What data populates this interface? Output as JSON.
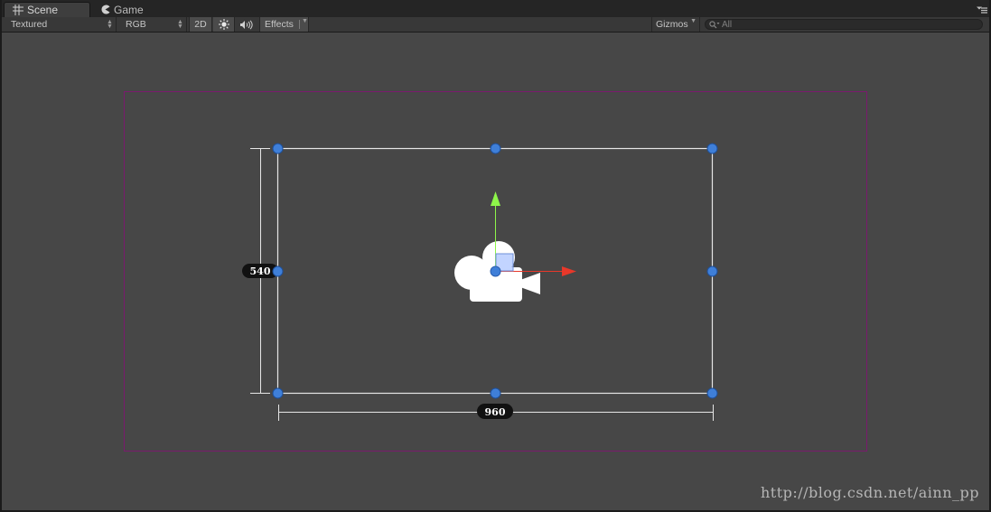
{
  "tabs": [
    {
      "label": "Scene",
      "icon": "scene-grid-icon",
      "active": true
    },
    {
      "label": "Game",
      "icon": "game-pacman-icon",
      "active": false
    }
  ],
  "toolbar": {
    "draw_mode": "Textured",
    "render_mode": "RGB",
    "mode_2d": "2D",
    "lighting_icon": "sun-icon",
    "audio_icon": "speaker-icon",
    "effects": "Effects",
    "gizmos": "Gizmos",
    "search_placeholder": "All"
  },
  "scene": {
    "width_label": "960",
    "height_label": "540",
    "camera_icon": "camera-icon",
    "colors": {
      "background": "#474747",
      "camera_bounds": "#7a1a6e",
      "rect_outline": "#e6e6e6",
      "handle": "#3f7fd8",
      "y_axis": "#8ef54a",
      "x_axis": "#e8382a"
    }
  },
  "watermark": "http://blog.csdn.net/ainn_pp"
}
